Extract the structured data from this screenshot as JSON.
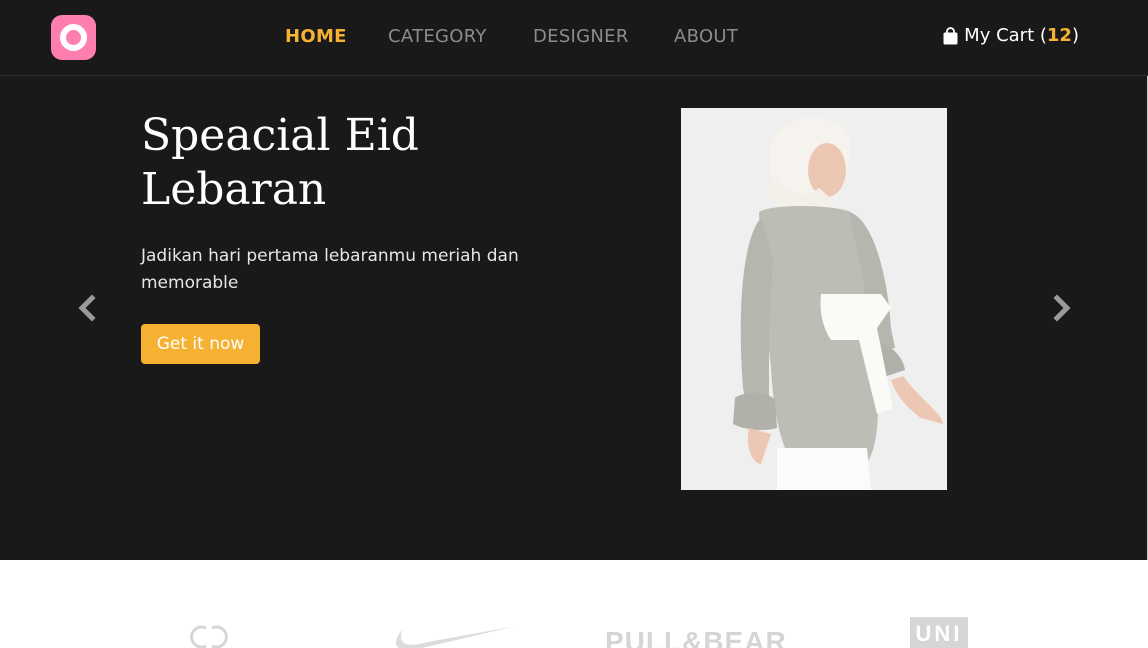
{
  "nav": {
    "links": [
      {
        "label": "HOME",
        "active": true
      },
      {
        "label": "CATEGORY",
        "active": false
      },
      {
        "label": "DESIGNER",
        "active": false
      },
      {
        "label": "ABOUT",
        "active": false
      }
    ],
    "cart": {
      "label": "My Cart",
      "open_paren": "(",
      "count": "12",
      "close_paren": ")",
      "icon": "shopping-bag-icon"
    },
    "logo_icon": "logo-icon"
  },
  "hero": {
    "title": "Speacial Eid Lebaran",
    "subtitle": "Jadikan hari pertama lebaranmu meriah dan memorable",
    "cta_label": "Get it now",
    "prev_icon": "chevron-left-icon",
    "next_icon": "chevron-right-icon"
  },
  "brands": {
    "items": [
      {
        "name": "chanel",
        "kind": "logo"
      },
      {
        "name": "nike",
        "kind": "logo"
      },
      {
        "name": "pull-bear",
        "text": "PULL&BEAR"
      },
      {
        "name": "uniqlo",
        "text": "UNI"
      }
    ]
  },
  "colors": {
    "accent": "#f6b132",
    "nav_background": "#1a191a",
    "logo": "#ff7eb0",
    "nav_inactive": "#8c8c8c"
  }
}
